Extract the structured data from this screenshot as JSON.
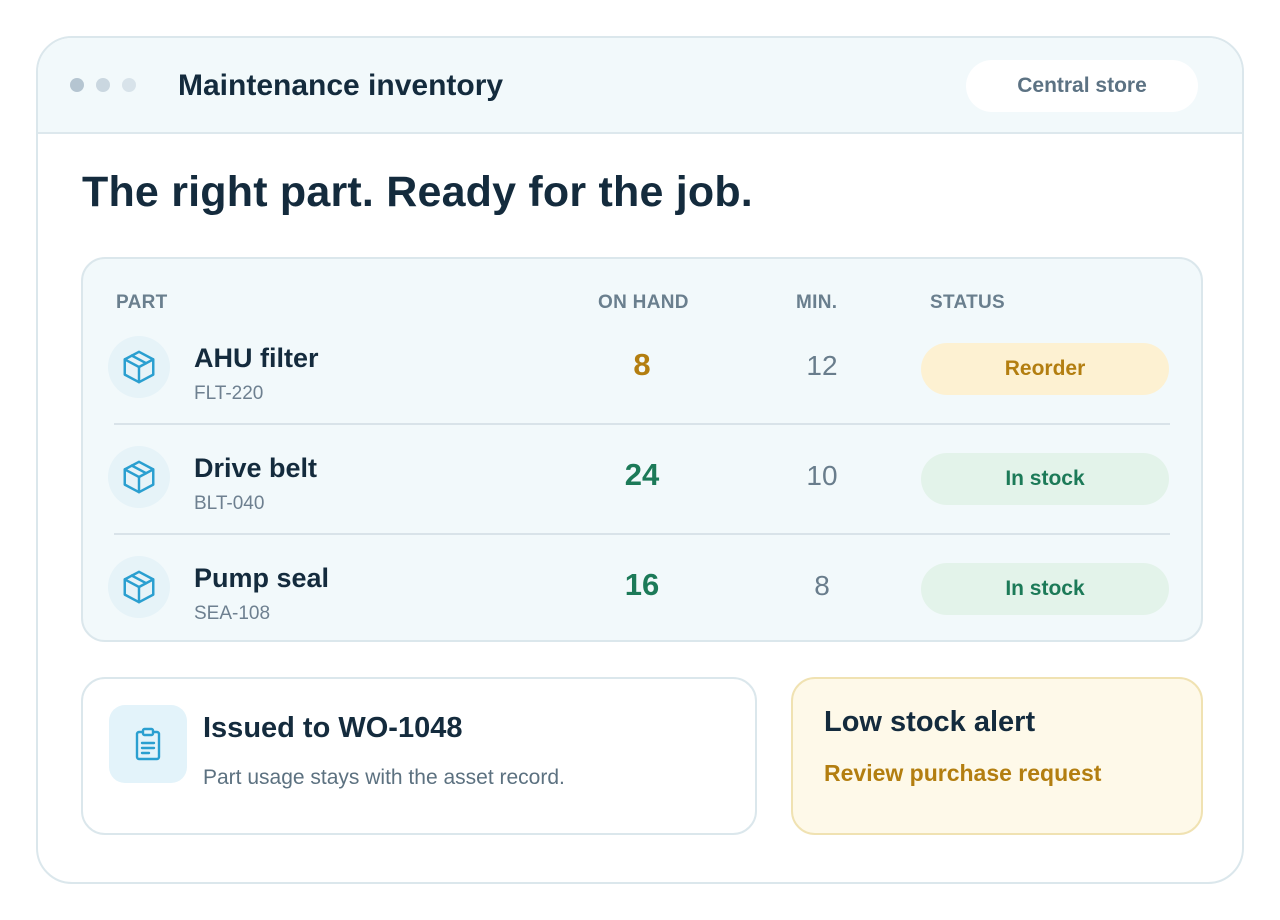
{
  "window": {
    "title": "Maintenance inventory",
    "location": "Central store"
  },
  "headline": "The right part. Ready for the job.",
  "table": {
    "columns": {
      "part": "PART",
      "on_hand": "ON HAND",
      "min": "MIN.",
      "status": "STATUS"
    },
    "rows": [
      {
        "name": "AHU filter",
        "code": "FLT-220",
        "on_hand": "8",
        "min": "12",
        "status": "Reorder",
        "status_kind": "reorder",
        "icon": "package-icon"
      },
      {
        "name": "Drive belt",
        "code": "BLT-040",
        "on_hand": "24",
        "min": "10",
        "status": "In stock",
        "status_kind": "in-stock",
        "icon": "package-icon"
      },
      {
        "name": "Pump seal",
        "code": "SEA-108",
        "on_hand": "16",
        "min": "8",
        "status": "In stock",
        "status_kind": "in-stock",
        "icon": "package-icon"
      }
    ]
  },
  "issued": {
    "title": "Issued to WO-1048",
    "description": "Part usage stays with the asset record.",
    "icon": "clipboard-icon"
  },
  "alert": {
    "title": "Low stock alert",
    "link": "Review purchase request"
  },
  "colors": {
    "accent_icon": "#2a9fd0",
    "reorder_text": "#b37e10",
    "reorder_bg": "#fdf1d2",
    "in_stock_text": "#1c7a58",
    "in_stock_bg": "#e3f3ea"
  }
}
